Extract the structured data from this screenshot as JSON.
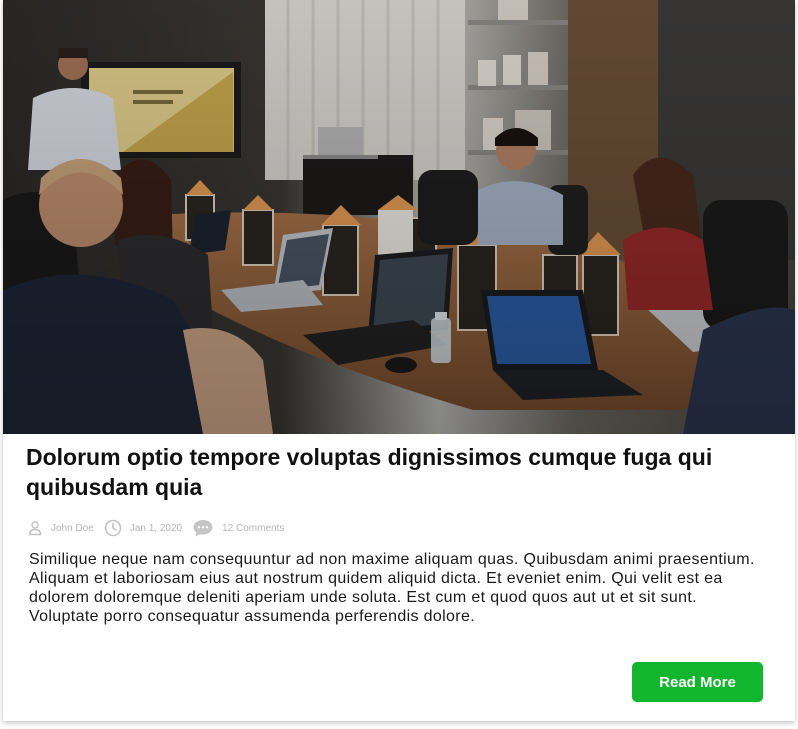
{
  "post": {
    "image_alt": "Team meeting around a conference table with laptops",
    "title": "Dolorum optio tempore voluptas dignissimos cumque fuga qui quibusdam quia",
    "author": "John Doe",
    "date": "Jan 1, 2020",
    "comments": "12 Comments",
    "excerpt": "Similique neque nam consequuntur ad non maxime aliquam quas. Quibusdam animi praesentium. Aliquam et laboriosam eius aut nostrum quidem aliquid dicta. Et eveniet enim. Qui velit est ea dolorem doloremque deleniti aperiam unde soluta. Est cum et quod quos aut ut et sit sunt. Voluptate porro consequatur assumenda perferendis dolore.",
    "read_more_label": "Read More"
  },
  "icons": {
    "author": "user-icon",
    "date": "clock-icon",
    "comments": "chat-bubble-icon"
  },
  "colors": {
    "accent": "#12b52e",
    "title": "#111111",
    "meta": "#b5b5b5",
    "body": "#1a1a1a"
  }
}
